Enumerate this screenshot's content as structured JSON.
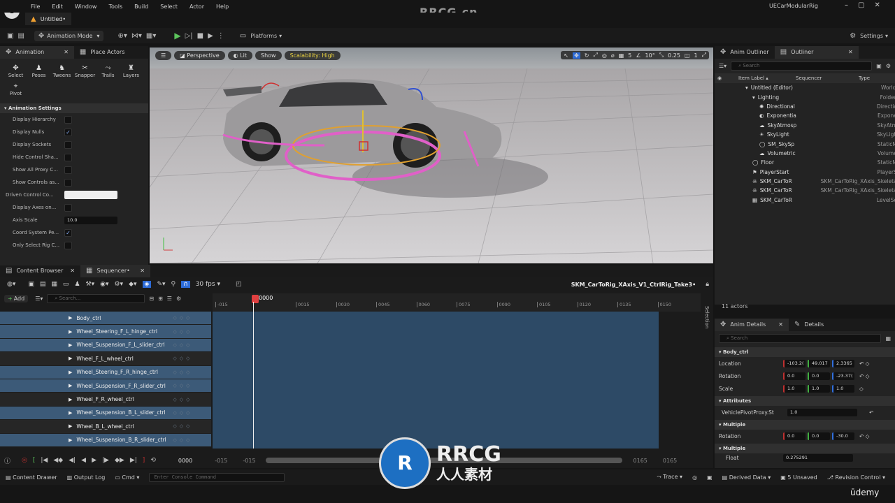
{
  "menubar": {
    "items": [
      "File",
      "Edit",
      "Window",
      "Tools",
      "Build",
      "Select",
      "Actor",
      "Help"
    ],
    "project": "UECarModularRig"
  },
  "tab": {
    "title": "Untitled•"
  },
  "watermark": {
    "top": "RRCG.cn",
    "bottom_main": "RRCG",
    "bottom_sub": "人人素材",
    "udemy": "ūdemy"
  },
  "toolbar": {
    "mode": "Animation Mode",
    "platforms": "Platforms",
    "settings": "Settings"
  },
  "left_panel": {
    "tabs": [
      "Animation",
      "Place Actors"
    ],
    "tools": [
      "Select",
      "Poses",
      "Tweens",
      "Snapper",
      "Trails",
      "Layers",
      "Pivot"
    ],
    "section": "Animation Settings",
    "settings": [
      {
        "label": "Display Hierarchy",
        "type": "cb",
        "checked": ""
      },
      {
        "label": "Display Nulls",
        "type": "cb",
        "checked": "✓"
      },
      {
        "label": "Display Sockets",
        "type": "cb",
        "checked": ""
      },
      {
        "label": "Hide Control Sha...",
        "type": "cb",
        "checked": ""
      },
      {
        "label": "Show All Proxy C...",
        "type": "cb",
        "checked": ""
      },
      {
        "label": "Show Controls as...",
        "type": "cb",
        "checked": ""
      },
      {
        "label": "Driven Control Co...",
        "type": "color",
        "checked": ""
      },
      {
        "label": "Display Axes on...",
        "type": "cb",
        "checked": ""
      },
      {
        "label": "Axis Scale",
        "type": "num",
        "checked": "10.0"
      },
      {
        "label": "Coord System Pe...",
        "type": "cb",
        "checked": "✓"
      },
      {
        "label": "Only Select Rig C...",
        "type": "cb",
        "checked": ""
      }
    ]
  },
  "viewport": {
    "perspective": "Perspective",
    "lit": "Lit",
    "show": "Show",
    "scalability": "Scalability: High",
    "grid": "5",
    "angle": "10°",
    "scale": "0.25",
    "cams": "1"
  },
  "outliner": {
    "tabs": [
      "Anim Outliner",
      "Outliner"
    ],
    "search": "Search",
    "cols": [
      "Item Label ▴",
      "Sequencer",
      "Type"
    ],
    "rows": [
      {
        "name": "Untitled (Editor)",
        "seq": "",
        "type": "World",
        "indent": 0,
        "icon": "▾"
      },
      {
        "name": "Lighting",
        "seq": "",
        "type": "Folder",
        "indent": 1,
        "icon": "▾"
      },
      {
        "name": "Directional",
        "seq": "",
        "type": "Directio",
        "indent": 2,
        "icon": "✺"
      },
      {
        "name": "Exponentia",
        "seq": "",
        "type": "Expone",
        "indent": 2,
        "icon": "◐"
      },
      {
        "name": "SkyAtmosp",
        "seq": "",
        "type": "SkyAtm",
        "indent": 2,
        "icon": "☁"
      },
      {
        "name": "SkyLight",
        "seq": "",
        "type": "SkyLigh",
        "indent": 2,
        "icon": "☀"
      },
      {
        "name": "SM_SkySp",
        "seq": "",
        "type": "StaticM",
        "indent": 2,
        "icon": "◯"
      },
      {
        "name": "Volumetric",
        "seq": "",
        "type": "Volume",
        "indent": 2,
        "icon": "☁"
      },
      {
        "name": "Floor",
        "seq": "",
        "type": "StaticM",
        "indent": 1,
        "icon": "◯"
      },
      {
        "name": "PlayerStart",
        "seq": "",
        "type": "PlayerS",
        "indent": 1,
        "icon": "⚑"
      },
      {
        "name": "SKM_CarToR",
        "seq": "SKM_CarToRig_XAxis_",
        "type": "Skeleta",
        "indent": 1,
        "icon": "☠"
      },
      {
        "name": "SKM_CarToR",
        "seq": "SKM_CarToRig_XAxis_",
        "type": "Skeleta",
        "indent": 1,
        "icon": "☠"
      },
      {
        "name": "SKM_CarToR",
        "seq": "",
        "type": "LevelSe",
        "indent": 1,
        "icon": "▦"
      }
    ],
    "count": "11 actors"
  },
  "bottom": {
    "tabs": [
      "Content Browser",
      "Sequencer•"
    ],
    "fps": "30 fps",
    "sequence_name": "SKM_CarToRig_XAxis_V1_CtrlRig_Take3•",
    "add": "Add",
    "search": "Search...",
    "ruler": [
      "-015",
      "0000",
      "0015",
      "0030",
      "0045",
      "0060",
      "0075",
      "0090",
      "0105",
      "0120",
      "0135",
      "0150"
    ],
    "current_frame": "0000",
    "tracks": [
      {
        "name": "Body_ctrl",
        "sel": true
      },
      {
        "name": "Wheel_Steering_F_L_hinge_ctrl",
        "sel": true
      },
      {
        "name": "Wheel_Suspension_F_L_slider_ctrl",
        "sel": true
      },
      {
        "name": "Wheel_F_L_wheel_ctrl",
        "sel": false
      },
      {
        "name": "Wheel_Steering_F_R_hinge_ctrl",
        "sel": true
      },
      {
        "name": "Wheel_Suspension_F_R_slider_ctrl",
        "sel": true
      },
      {
        "name": "Wheel_F_R_wheel_ctrl",
        "sel": false
      },
      {
        "name": "Wheel_Suspension_B_L_slider_ctrl",
        "sel": true
      },
      {
        "name": "Wheel_B_L_wheel_ctrl",
        "sel": false
      },
      {
        "name": "Wheel_Suspension_B_R_slider_ctrl",
        "sel": true
      }
    ],
    "transport": {
      "frame": "0000",
      "start1": "-015",
      "start2": "-015",
      "end1": "0165",
      "end2": "0165"
    },
    "selection_label": "Selection"
  },
  "details": {
    "tabs": [
      "Anim Details",
      "Details"
    ],
    "search": "Search",
    "sections": {
      "body": "Body_ctrl",
      "location": {
        "label": "Location",
        "vals": [
          "-103.2(",
          "49.017",
          "2.3365"
        ]
      },
      "rotation": {
        "label": "Rotation",
        "vals": [
          "0.0",
          "0.0",
          "-23.37("
        ]
      },
      "scale": {
        "label": "Scale",
        "vals": [
          "1.0",
          "1.0",
          "1.0"
        ]
      },
      "attributes": "Attributes",
      "attr": {
        "label": "VehiclePivotProxy.St",
        "val": "1.0"
      },
      "multiple1": "Multiple",
      "rotation2": {
        "label": "Rotation",
        "vals": [
          "0.0",
          "0.0",
          "-30.0"
        ]
      },
      "multiple2": "Multiple",
      "float": {
        "label": "Float",
        "val": "0.275291"
      }
    }
  },
  "status": {
    "content_drawer": "Content Drawer",
    "output_log": "Output Log",
    "cmd": "Cmd",
    "console": "Enter Console Command",
    "trace": "Trace",
    "derived": "Derived Data",
    "unsaved": "5 Unsaved",
    "revision": "Revision Control"
  }
}
